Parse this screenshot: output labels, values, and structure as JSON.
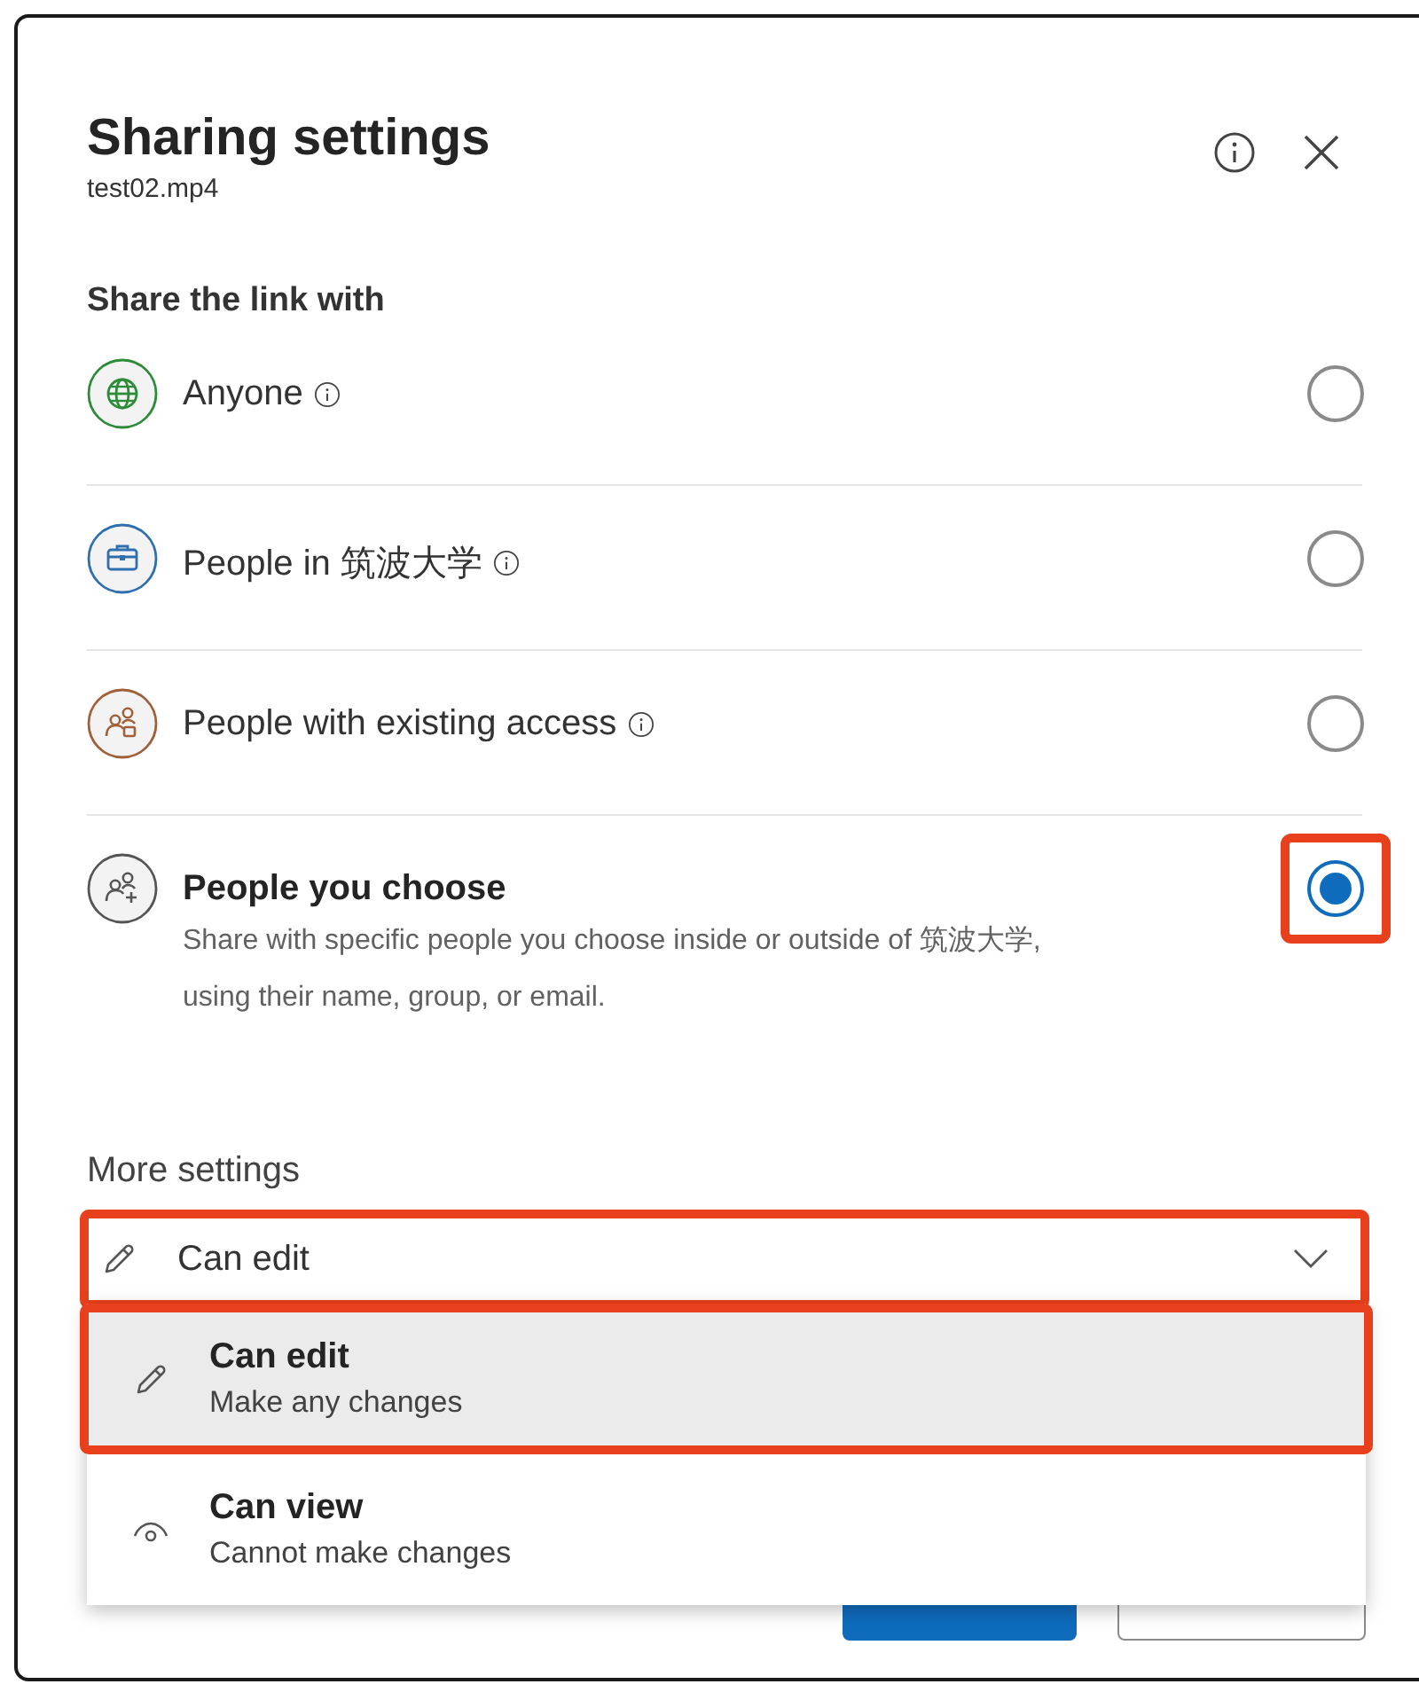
{
  "dialog": {
    "title": "Sharing settings",
    "subtitle": "test02.mp4"
  },
  "share_section": {
    "heading": "Share the link with",
    "options": [
      {
        "kind": "globe",
        "label": "Anyone",
        "info": true,
        "color": "#2e8b3a",
        "selected": false,
        "highlighted": false
      },
      {
        "kind": "organization",
        "label": "People in 筑波大学",
        "info": true,
        "color": "#2f6fb0",
        "selected": false,
        "highlighted": false
      },
      {
        "kind": "existing",
        "label": "People with existing access",
        "info": true,
        "color": "#a0613a",
        "selected": false,
        "highlighted": false
      },
      {
        "kind": "choose",
        "label": "People you choose",
        "description": "Share with specific people you choose inside or outside of 筑波大学, using their name, group, or email.",
        "info": false,
        "color": "#555555",
        "selected": true,
        "highlighted": true
      }
    ]
  },
  "more_settings": {
    "heading": "More settings",
    "dropdown": {
      "value": "Can edit",
      "expanded": true,
      "highlighted": true
    },
    "menu": [
      {
        "kind": "edit",
        "label": "Can edit",
        "description": "Make any changes",
        "selected": true,
        "highlighted": true
      },
      {
        "kind": "view",
        "label": "Can view",
        "description": "Cannot make changes",
        "selected": false,
        "highlighted": false
      }
    ]
  }
}
